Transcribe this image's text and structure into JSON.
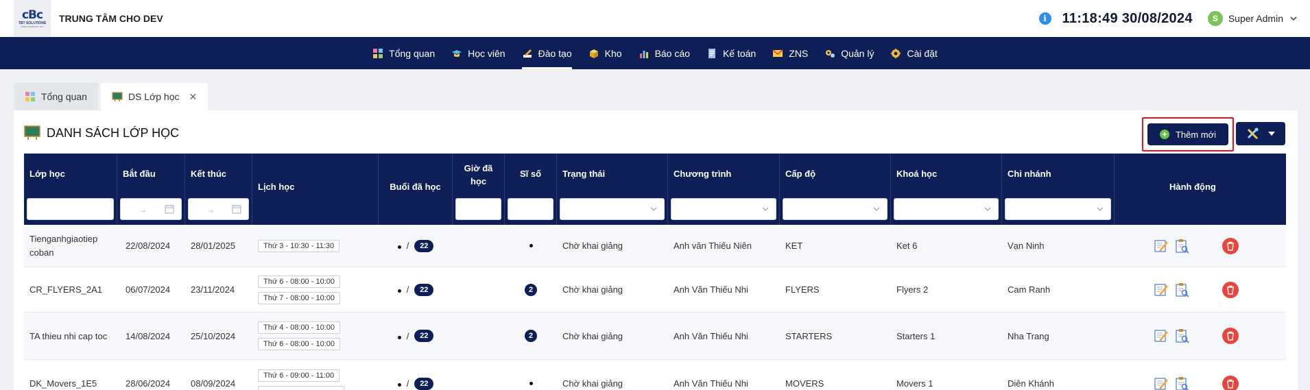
{
  "header": {
    "logo_mark": "cBc",
    "logo_sub": "TBT SOLUTIONS",
    "logo_tagline": "CÔNG NGHỆ ĐÀO TẠO",
    "center_name": "TRUNG TÂM CHO DEV",
    "datetime": "11:18:49 30/08/2024",
    "avatar_letter": "S",
    "user_name": "Super Admin"
  },
  "nav": {
    "items": [
      {
        "label": "Tổng quan",
        "icon": "dashboard-grid-icon"
      },
      {
        "label": "Học viên",
        "icon": "graduation-cap-icon"
      },
      {
        "label": "Đào tạo",
        "icon": "pencil-book-icon",
        "active": true
      },
      {
        "label": "Kho",
        "icon": "box-icon"
      },
      {
        "label": "Báo cáo",
        "icon": "bar-chart-icon"
      },
      {
        "label": "Kế toán",
        "icon": "ledger-icon"
      },
      {
        "label": "ZNS",
        "icon": "message-envelope-icon"
      },
      {
        "label": "Quản lý",
        "icon": "gear-people-icon"
      },
      {
        "label": "Cài đặt",
        "icon": "gear-icon"
      }
    ]
  },
  "tabs": [
    {
      "label": "Tổng quan",
      "icon": "dashboard-grid-icon"
    },
    {
      "label": "DS Lớp học",
      "icon": "chalkboard-icon",
      "active": true
    }
  ],
  "page": {
    "title": "DANH SÁCH LỚP HỌC",
    "add_label": "Thêm mới"
  },
  "table": {
    "headers": {
      "lop_hoc": "Lớp học",
      "bat_dau": "Bắt đầu",
      "ket_thuc": "Kết thúc",
      "lich_hoc": "Lịch học",
      "buoi_da_hoc": "Buổi đã học",
      "gio_da_hoc": "Giờ đã học",
      "si_so": "Sĩ số",
      "trang_thai": "Trạng thái",
      "chuong_trinh": "Chương trình",
      "cap_do": "Cấp độ",
      "khoa_hoc": "Khoá học",
      "chi_nhanh": "Chi nhánh",
      "hanh_dong": "Hành động"
    },
    "date_range_separator": "→",
    "rows": [
      {
        "name": "Tienganhgiaotiep coban",
        "start": "22/08/2024",
        "end": "28/01/2025",
        "schedule": [
          "Thứ 3 - 10:30 - 11:30"
        ],
        "sessions_done": "•",
        "separator": "/",
        "sessions_total": "22",
        "hours_done": "",
        "size": "•",
        "status": "Chờ khai giảng",
        "program": "Anh văn Thiếu Niên",
        "level": "KET",
        "course": "Ket 6",
        "branch": "Vạn Ninh"
      },
      {
        "name": "CR_FLYERS_2A1",
        "start": "06/07/2024",
        "end": "23/11/2024",
        "schedule": [
          "Thứ 6 - 08:00 - 10:00",
          "Thứ 7 - 08:00 - 10:00"
        ],
        "sessions_done": "•",
        "separator": "/",
        "sessions_total": "22",
        "hours_done": "",
        "size": "2",
        "status": "Chờ khai giảng",
        "program": "Anh Văn Thiếu Nhi",
        "level": "FLYERS",
        "course": "Flyers 2",
        "branch": "Cam Ranh"
      },
      {
        "name": "TA thieu nhi cap toc",
        "start": "14/08/2024",
        "end": "25/10/2024",
        "schedule": [
          "Thứ 4 - 08:00 - 10:00",
          "Thứ 6 - 08:00 - 10:00"
        ],
        "sessions_done": "•",
        "separator": "/",
        "sessions_total": "22",
        "hours_done": "",
        "size": "2",
        "status": "Chờ khai giảng",
        "program": "Anh Văn Thiếu Nhi",
        "level": "STARTERS",
        "course": "Starters 1",
        "branch": "Nha Trang"
      },
      {
        "name": "DK_Movers_1E5",
        "start": "28/06/2024",
        "end": "08/09/2024",
        "schedule": [
          "Thứ 6 - 09:00 - 11:00",
          ""
        ],
        "sessions_done": "•",
        "separator": "/",
        "sessions_total": "22",
        "hours_done": "",
        "size": "•",
        "status": "Chờ khai giảng",
        "program": "Anh Văn Thiếu Nhi",
        "level": "MOVERS",
        "course": "Movers 1",
        "branch": "Diên Khánh"
      }
    ]
  },
  "colors": {
    "navy": "#0d1f56",
    "accent_red": "#e8121c",
    "add_plus_green": "#6cc04a",
    "delete_red": "#e8453c",
    "info_blue": "#2f8fe8"
  }
}
